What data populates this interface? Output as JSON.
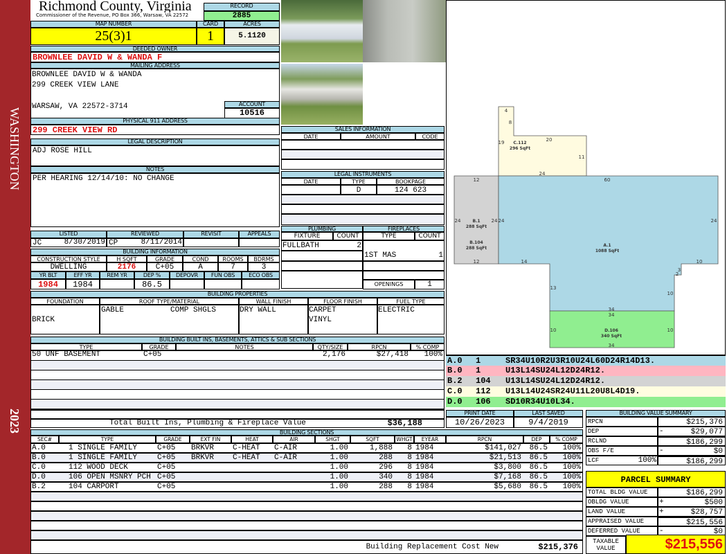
{
  "strip": {
    "district": "WASHINGTON",
    "year": "2023"
  },
  "header": {
    "county": "Richmond County, Virginia",
    "commissioner": "Commissioner of the Revenue, PO Box 366, Warsaw, VA 22572",
    "record_label": "RECORD",
    "record": "2885"
  },
  "parcel": {
    "map_number_label": "MAP NUMBER",
    "map_number": "25(3)1",
    "card_label": "CARD",
    "card": "1",
    "acres_label": "ACRES",
    "acres": "5.1120"
  },
  "owner": {
    "label": "DEEDED OWNER",
    "name": "BROWNLEE DAVID W & WANDA F"
  },
  "mailing": {
    "label": "MAILING ADDRESS",
    "lines": [
      "BROWNLEE DAVID W & WANDA",
      "299 CREEK VIEW LANE",
      "WARSAW, VA 22572-3714"
    ]
  },
  "account": {
    "label": "ACCOUNT",
    "value": "10516"
  },
  "physical": {
    "label": "PHYSICAL 911 ADDRESS",
    "value": "299 CREEK VIEW RD"
  },
  "legal": {
    "label": "LEGAL DESCRIPTION",
    "value": "ADJ ROSE HILL"
  },
  "notes": {
    "label": "NOTES",
    "value": "PER HEARING 12/14/10: NO CHANGE"
  },
  "sales": {
    "label": "SALES INFORMATION",
    "cols": [
      "DATE",
      "AMOUNT",
      "CODE"
    ]
  },
  "instruments": {
    "label": "LEGAL INSTRUMENTS",
    "cols": [
      "DATE",
      "TYPE",
      "BOOKPAGE"
    ],
    "row": {
      "date": "",
      "type": "D",
      "bookpage": "124 623"
    }
  },
  "listing": {
    "cols": [
      "LISTED",
      "REVIEWED",
      "REVISIT",
      "APPEALS"
    ],
    "listed_by": "JC",
    "listed_date": "8/30/2019",
    "reviewed_by": "CP",
    "reviewed_date": "8/11/2014",
    "revisit": "",
    "appeals": ""
  },
  "building_info": {
    "label": "BUILDING INFORMATION",
    "cols1": [
      "CONSTRUCTION STYLE",
      "H SQFT",
      "GRADE",
      "COND",
      "ROOMS",
      "BDRMS"
    ],
    "vals1": [
      "DWELLING",
      "2176",
      "C+05",
      "A",
      "7",
      "3"
    ],
    "cols2": [
      "YR BLT",
      "EFF YR",
      "REM YR",
      "DEP %",
      "DEPOVR",
      "FUN OBS",
      "ECO OBS"
    ],
    "vals2": [
      "1984",
      "1984",
      "",
      "86.5",
      "",
      "",
      ""
    ]
  },
  "plumbing": {
    "label": "PLUMBING",
    "cols": [
      "FIXTURE",
      "COUNT"
    ],
    "fixture": "FULLBATH",
    "count": "2"
  },
  "fireplaces": {
    "label": "FIREPLACES",
    "cols": [
      "TYPE",
      "COUNT"
    ],
    "type": "1ST MAS",
    "count": "1",
    "openings_label": "OPENINGS",
    "openings": "1"
  },
  "properties": {
    "label": "BUILDING PROPERTIES",
    "cols": [
      "FOUNDATION",
      "ROOF TYPE/MATERIAL",
      "WALL FINISH",
      "FLOOR FINISH",
      "FUEL TYPE"
    ],
    "foundation": "BRICK",
    "roof_type": "GABLE",
    "roof_material": "COMP SHGLS",
    "wall": "DRY WALL",
    "floor1": "CARPET",
    "floor2": "VINYL",
    "fuel": "ELECTRIC"
  },
  "builtins": {
    "label": "BUILDING BUILT INS, BASEMENTS, ATTICS & SUB SECTIONS",
    "cols": [
      "TYPE",
      "GRADE",
      "NOTES",
      "QTY/SIZE",
      "RPCN",
      "% COMP"
    ],
    "row": [
      "50 UNF BASEMENT",
      "C+05",
      "",
      "2,176",
      "$27,418",
      "100%"
    ],
    "total_label": "Total Built Ins, Plumbing & Fireplace Value",
    "total": "$36,188"
  },
  "dates": {
    "print_label": "PRINT DATE",
    "print": "10/26/2023",
    "saved_label": "LAST SAVED",
    "saved": "9/4/2019"
  },
  "sections": {
    "label": "BUILDING SECTIONS",
    "cols": [
      "SEC#",
      "TYPE",
      "GRADE",
      "EXT FIN",
      "HEAT",
      "AIR",
      "SHGT",
      "SQFT",
      "WHGT",
      "EYEAR",
      "RPCN",
      "DEP",
      "% COMP"
    ],
    "rows": [
      [
        "A.0",
        "1 SINGLE FAMILY",
        "C+05",
        "BRKVR",
        "C-HEAT",
        "C-AIR",
        "1.00",
        "1,888",
        "8",
        "1984",
        "$141,027",
        "86.5",
        "100%"
      ],
      [
        "B.0",
        "1 SINGLE FAMILY",
        "C+05",
        "BRKVR",
        "C-HEAT",
        "C-AIR",
        "1.00",
        "288",
        "8",
        "1984",
        "$21,513",
        "86.5",
        "100%"
      ],
      [
        "C.0",
        "112 WOOD DECK",
        "C+05",
        "",
        "",
        "",
        "1.00",
        "296",
        "8",
        "1984",
        "$3,800",
        "86.5",
        "100%"
      ],
      [
        "D.0",
        "106 OPEN MSNRY PCH",
        "C+05",
        "",
        "",
        "",
        "1.00",
        "340",
        "8",
        "1984",
        "$7,168",
        "86.5",
        "100%"
      ],
      [
        "B.2",
        "104 CARPORT",
        "C+05",
        "",
        "",
        "",
        "1.00",
        "288",
        "8",
        "1984",
        "$5,680",
        "86.5",
        "100%"
      ]
    ],
    "total_label": "Building Replacement Cost New",
    "total": "$215,376"
  },
  "value_summary": {
    "label": "BUILDING VALUE SUMMARY",
    "rows": [
      {
        "label": "RPCN",
        "extra": "",
        "sign": "",
        "value": "$215,376"
      },
      {
        "label": "DEP",
        "extra": "",
        "sign": "-",
        "value": "$29,077"
      },
      {
        "label": "RCLND",
        "extra": "",
        "sign": "",
        "value": "$186,299"
      },
      {
        "label": "OBS F/E",
        "extra": "",
        "sign": "-",
        "value": "$0"
      },
      {
        "label": "LCF",
        "extra": "100%",
        "sign": "",
        "value": "$186,299"
      }
    ]
  },
  "parcel_summary": {
    "label": "PARCEL SUMMARY",
    "rows": [
      {
        "label": "TOTAL BLDG VALUE",
        "sign": "",
        "value": "$186,299"
      },
      {
        "label": "OBLDG VALUE",
        "sign": "+",
        "value": "$500"
      },
      {
        "label": "LAND VALUE",
        "sign": "+",
        "value": "$28,757"
      },
      {
        "label": "APPRAISED VALUE",
        "sign": "",
        "value": "$215,556"
      },
      {
        "label": "DEFERRED VALUE",
        "sign": "-",
        "value": "$0"
      }
    ],
    "taxable_label": "TAXABLE VALUE",
    "taxable": "$215,556"
  },
  "sketch": {
    "areas": [
      {
        "name": "C.112",
        "sqft": "296 SqFt"
      },
      {
        "name": "B.1",
        "sqft": "288 SqFt"
      },
      {
        "name": "B.104",
        "sqft": "288 SqFt"
      },
      {
        "name": "A.1",
        "sqft": "1088 SqFt"
      },
      {
        "name": "D.106",
        "sqft": "340 SqFt"
      }
    ],
    "dims": [
      "4",
      "8",
      "19",
      "20",
      "11",
      "24",
      "60",
      "12",
      "24",
      "24",
      "24",
      "24",
      "12",
      "14",
      "10",
      "3",
      "2",
      "13",
      "10",
      "34",
      "34",
      "10",
      "10",
      "34"
    ],
    "legend": [
      {
        "sec": "A.0",
        "code": "1",
        "path": "SR34U10R2U3R10U24L60D24R14D13.",
        "color": "#add8e6"
      },
      {
        "sec": "B.0",
        "code": "1",
        "path": "U13L14SU24L12D24R12.",
        "color": "#ffb6c1"
      },
      {
        "sec": "B.2",
        "code": "104",
        "path": "U13L14SU24L12D24R12.",
        "color": "#d3d3d3"
      },
      {
        "sec": "C.0",
        "code": "112",
        "path": "U13L14U24SR24U11L20U8L4D19.",
        "color": "#fffde0"
      },
      {
        "sec": "D.0",
        "code": "106",
        "path": "SD10R34U10L34.",
        "color": "#90ee90"
      }
    ]
  }
}
